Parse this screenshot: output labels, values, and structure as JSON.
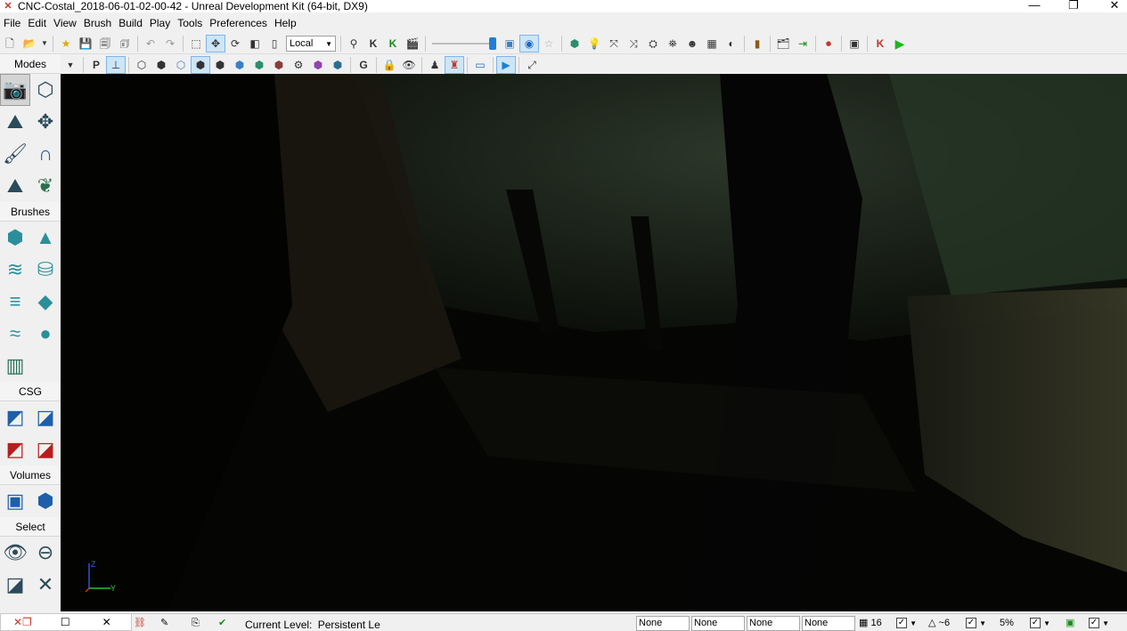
{
  "window": {
    "title": "CNC-Costal_2018-06-01-02-00-42 - Unreal Development Kit (64-bit, DX9)",
    "minimize_icon": "minimize-icon",
    "maximize_icon": "maximize-icon",
    "close_icon": "close-icon"
  },
  "menu": [
    "File",
    "Edit",
    "View",
    "Brush",
    "Build",
    "Play",
    "Tools",
    "Preferences",
    "Help"
  ],
  "toolbar": {
    "coordinate_system": "Local",
    "camera_speed_fraction": 1.0,
    "letter_buttons": [
      "P",
      "G"
    ]
  },
  "modes_panel": {
    "modes_label": "Modes",
    "brushes_label": "Brushes",
    "csg_label": "CSG",
    "volumes_label": "Volumes",
    "select_label": "Select",
    "mode_icons": [
      "camera-mode-icon",
      "geometry-mode-icon",
      "terrain-mode-icon",
      "texture-align-icon",
      "mesh-paint-icon",
      "static-mesh-mode-icon",
      "landscape-mode-icon",
      "foliage-mode-icon"
    ],
    "brush_icons": [
      "cube-brush-icon",
      "cone-brush-icon",
      "curved-stair-icon",
      "cylinder-brush-icon",
      "linear-stair-icon",
      "sheet-brush-icon",
      "spiral-stair-icon",
      "sphere-brush-icon",
      "volumetric-brush-icon"
    ],
    "csg_icons": [
      "csg-add-icon",
      "csg-subtract-icon",
      "csg-intersect-icon",
      "csg-deintersect-icon"
    ],
    "volume_icons": [
      "add-volume-icon",
      "volume-shape-icon"
    ],
    "select_icons": [
      "show-selected-icon",
      "hide-selected-icon",
      "select-invert-icon",
      "show-all-icon"
    ]
  },
  "viewport": {
    "axis_z": "Z",
    "axis_y": "Y"
  },
  "statusbar": {
    "current_level_label": "Current Level:",
    "current_level_value": "Persistent Le",
    "fields": [
      "None",
      "None",
      "None",
      "None"
    ],
    "grid_value": "16",
    "rotation_value": "~6",
    "scale_value": "5%"
  },
  "colors": {
    "background": "#f0f0f0",
    "viewport": "#050604",
    "accent_blue": "#1f7fd6",
    "play_green": "#1db51d",
    "csg_red": "#b91c1c"
  }
}
